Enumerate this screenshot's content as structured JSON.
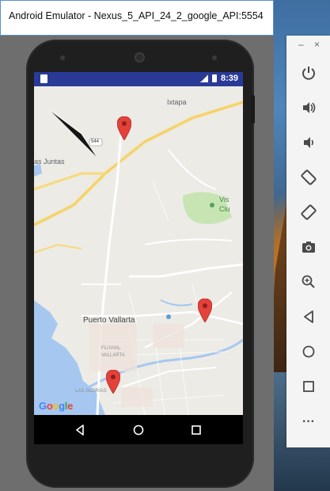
{
  "window": {
    "title": "Android Emulator - Nexus_5_API_24_2_google_API:5554"
  },
  "status_bar": {
    "time": "8:39",
    "signal": "4G"
  },
  "map": {
    "labels": {
      "ixtapa": "Ixtapa",
      "las_juntas": "as Juntas",
      "puerto_vallarta": "Puerto Vallarta",
      "fluvial": "FLUVIAL",
      "vallarta": "VALLARTA",
      "las_glorias": "LAS GLORIAS",
      "vista_club_1": "Vis",
      "vista_club_2": "Clu",
      "highway": "544"
    },
    "markers": [
      {
        "name": "marker-north"
      },
      {
        "name": "marker-east"
      },
      {
        "name": "marker-south"
      }
    ],
    "attribution": [
      "G",
      "o",
      "o",
      "g",
      "l",
      "e"
    ]
  },
  "nav_bar": {
    "back": "back-icon",
    "home": "home-icon",
    "recents": "recents-icon"
  },
  "side_toolbar": {
    "minimize": "–",
    "close": "×",
    "tools": [
      "power-icon",
      "volume-up-icon",
      "volume-down-icon",
      "rotate-left-icon",
      "rotate-right-icon",
      "camera-icon",
      "zoom-icon",
      "back-icon",
      "home-icon",
      "overview-icon",
      "more-icon"
    ],
    "more_label": "···"
  },
  "colors": {
    "status_bar": "#2a3a97",
    "marker": "#e3413a",
    "map_bg": "#ecebe6",
    "water": "#a6c8f0",
    "park": "#c7e5b3",
    "highway": "#f8d978"
  }
}
